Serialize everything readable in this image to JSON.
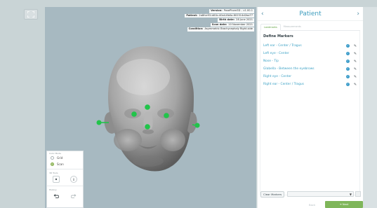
{
  "toolbar": {
    "fullscreen_icon": "expand-icon"
  },
  "viewer_info": [
    {
      "key": "Version:",
      "value": "PosePhore3D – v1.00.1"
    },
    {
      "key": "Patient:",
      "value": "2a8fce93-b81b-40a4-8b0a-802314d2ba77"
    },
    {
      "key": "Birth date:",
      "value": "28 June 2021"
    },
    {
      "key": "Scan date:",
      "value": "10 November 2021"
    },
    {
      "key": "Condition:",
      "value": "Asymmetric Brachycephaly Right-side"
    }
  ],
  "controls": {
    "view_label": "Color Mode",
    "options": [
      {
        "label": "Grid",
        "selected": false
      },
      {
        "label": "Scan",
        "selected": true
      }
    ],
    "tools_label": "3D Tools",
    "history_label": "History",
    "icons": {
      "center": "target-icon",
      "info": "info-icon",
      "undo": "undo-icon",
      "redo": "redo-icon"
    }
  },
  "panel": {
    "title": "Patient",
    "prev_icon": "chevron-left-icon",
    "next_icon": "chevron-right-icon",
    "tabs": [
      {
        "label": "Landmarks",
        "active": true
      },
      {
        "label": "Measurements",
        "active": false
      }
    ],
    "section_title": "Define Markers",
    "markers": [
      "Left ear - Center / Tragus",
      "Left eye - Center",
      "Nose - Tip",
      "Glabella - Between the eyebrows",
      "Right eye - Center",
      "Right ear - Center / Tragus"
    ],
    "check_icon": "check-icon",
    "edit_icon": "pencil-icon",
    "clear_label": "Clear Markers",
    "back_label": "Back",
    "next_label": "Next"
  },
  "colors": {
    "accent_blue": "#3a9bbd",
    "accent_green": "#7fb65a",
    "marker_green": "#21c44a",
    "viewer_bg": "#a7b9c1"
  }
}
